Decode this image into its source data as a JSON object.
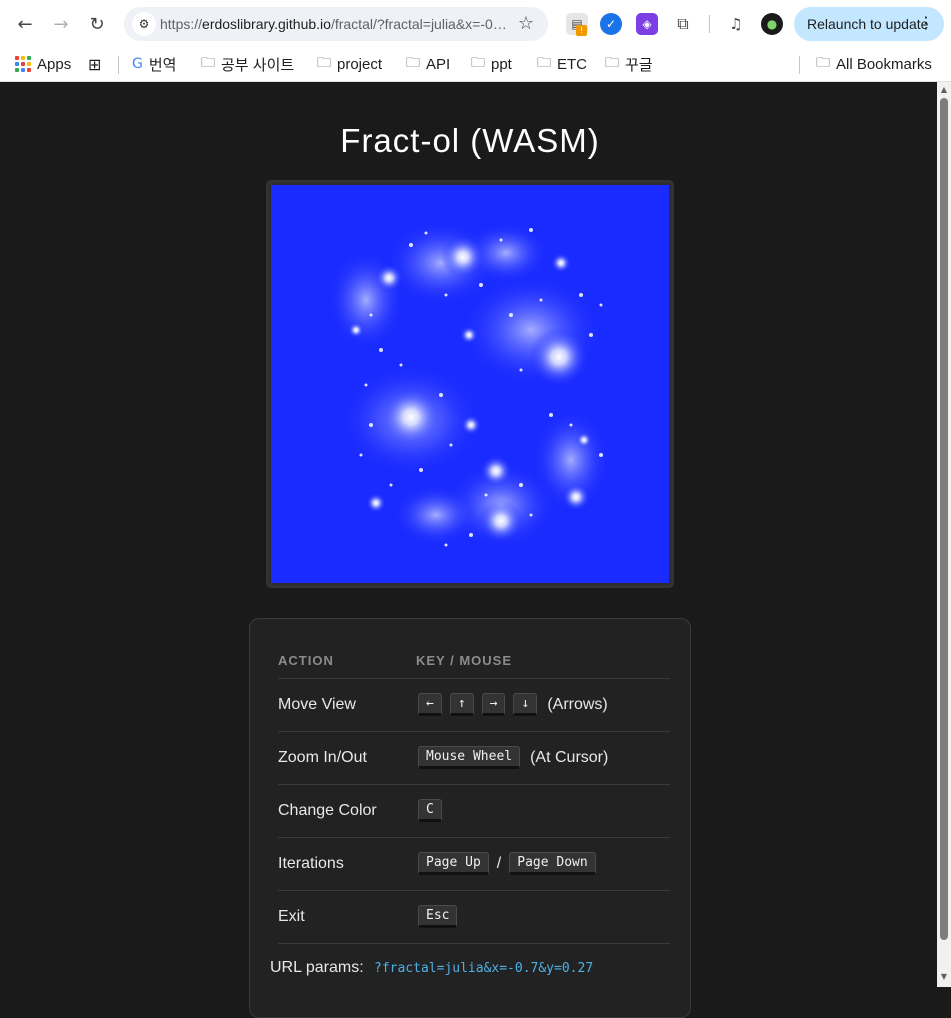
{
  "browser": {
    "url_prefix": "https://",
    "url_host": "erdoslibrary.github.io",
    "url_rest": "/fractal/?fractal=julia&x=-0.7&y=0.27",
    "relaunch_label": "Relaunch to update",
    "bookmarks": [
      {
        "label": "Apps"
      },
      {
        "label": "번역"
      },
      {
        "label": "공부 사이트"
      },
      {
        "label": "project"
      },
      {
        "label": "API"
      },
      {
        "label": "ppt"
      },
      {
        "label": "ETC"
      },
      {
        "label": "꾸글"
      }
    ],
    "all_bookmarks_label": "All Bookmarks"
  },
  "page": {
    "title": "Fract-ol (WASM)",
    "fractal_colors": {
      "background": "#1a2bff",
      "glow": "#ffffff"
    },
    "controls": {
      "header_action": "ACTION",
      "header_keys": "KEY / MOUSE",
      "rows": [
        {
          "action": "Move View",
          "keys": [
            "←",
            "↑",
            "→",
            "↓"
          ],
          "note": "(Arrows)"
        },
        {
          "action": "Zoom In/Out",
          "keys": [
            "Mouse Wheel"
          ],
          "note": "(At Cursor)"
        },
        {
          "action": "Change Color",
          "keys": [
            "C"
          ],
          "note": ""
        },
        {
          "action": "Iterations",
          "keys": [
            "Page Up",
            "Page Down"
          ],
          "separator": "/"
        },
        {
          "action": "Exit",
          "keys": [
            "Esc"
          ],
          "note": ""
        }
      ],
      "url_params_label": "URL params:",
      "url_params_value": "?fractal=julia&x=-0.7&y=0.27"
    }
  }
}
